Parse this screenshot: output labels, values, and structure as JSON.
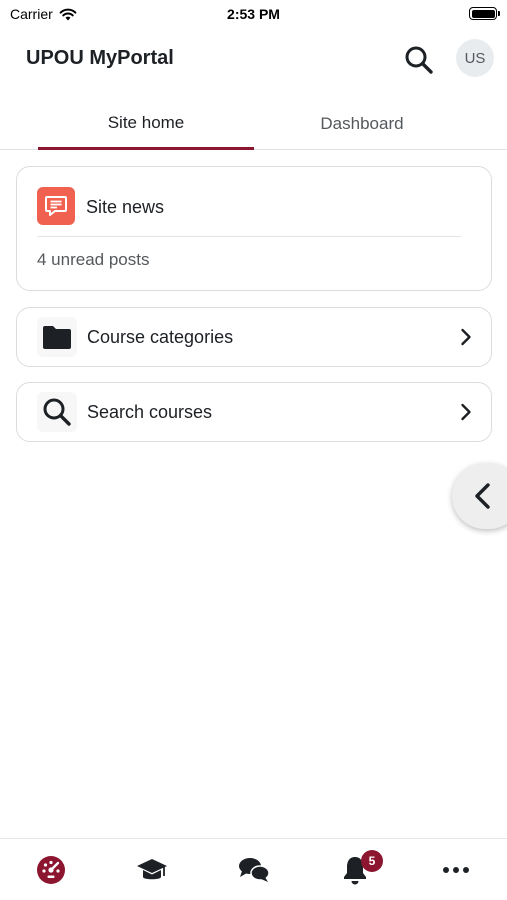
{
  "status_bar": {
    "carrier": "Carrier",
    "time": "2:53 PM"
  },
  "header": {
    "title": "UPOU MyPortal",
    "search_icon": "search-icon",
    "avatar_initials": "US"
  },
  "tabs": [
    {
      "label": "Site home",
      "active": true
    },
    {
      "label": "Dashboard",
      "active": false
    }
  ],
  "site_news": {
    "title": "Site news",
    "unread": "4 unread posts",
    "icon": "news-icon",
    "icon_color": "#f0624f"
  },
  "links": [
    {
      "label": "Course categories",
      "icon": "folder-icon"
    },
    {
      "label": "Search courses",
      "icon": "search-icon"
    }
  ],
  "bottom_nav": {
    "items": [
      {
        "name": "home",
        "icon": "dashboard-gauge-icon",
        "active": true
      },
      {
        "name": "my-courses",
        "icon": "graduation-cap-icon"
      },
      {
        "name": "messages",
        "icon": "chat-bubbles-icon"
      },
      {
        "name": "notifications",
        "icon": "bell-icon",
        "badge": "5"
      },
      {
        "name": "more",
        "icon": "more-dots-icon"
      }
    ]
  },
  "colors": {
    "accent": "#8c1530",
    "text": "#1d2125",
    "muted": "#55595d"
  }
}
